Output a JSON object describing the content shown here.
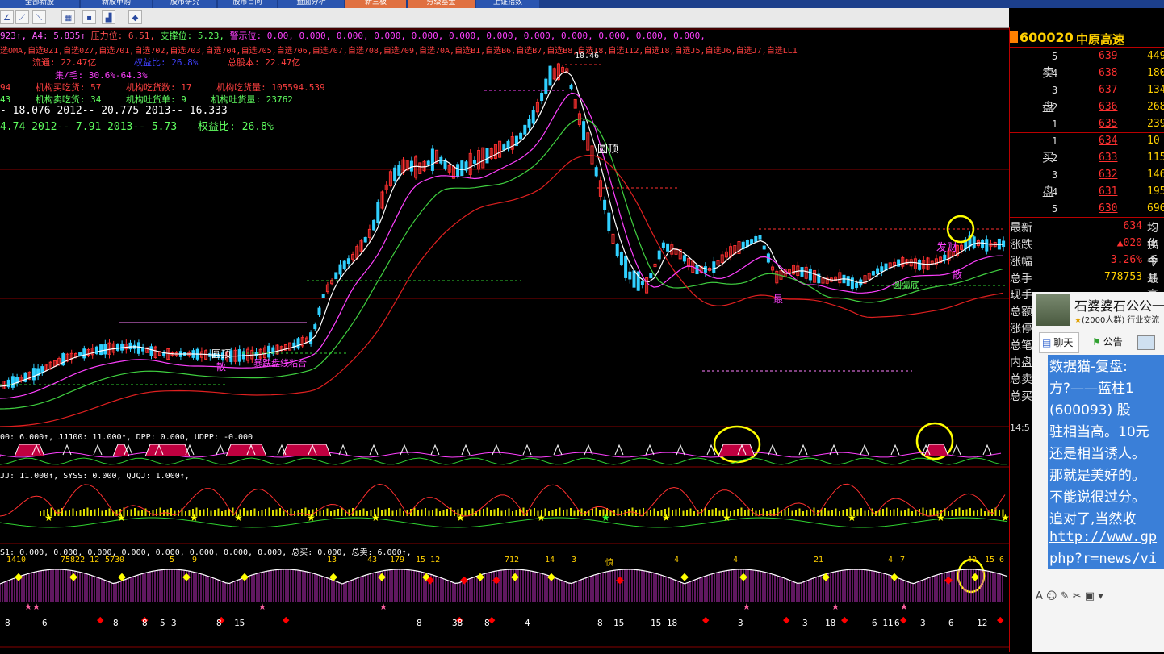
{
  "tabs": [
    {
      "label": "全部新股",
      "bg": "#2a55b0"
    },
    {
      "label": "新股申购",
      "bg": "#2a55b0"
    },
    {
      "label": "股市研究",
      "bg": "#2a55b0"
    },
    {
      "label": "股市百问",
      "bg": "#2a55b0"
    },
    {
      "label": "盘面分析",
      "bg": "#2a55b0"
    },
    {
      "label": "新三板",
      "bg": "#e07040"
    },
    {
      "label": "分级基金",
      "bg": "#e07040"
    },
    {
      "label": "上证指数",
      "bg": "#2a55b0"
    }
  ],
  "toolbar": {
    "icons": [
      "angle-tool-icon",
      "line-tool-icon",
      "ray-tool-icon",
      "table-icon",
      "note-icon",
      "chart-settings-icon",
      "diamond-icon"
    ]
  },
  "info": {
    "line1_a": "923↑, A4: 5.835↑",
    "line1_b": "压力位: 6.51,",
    "line1_c": "支撑位: 5.23,",
    "line1_d": "警示位: 0.00, 0.000, 0.000, 0.000, 0.000, 0.000, 0.000, 0.000, 0.000, 0.000, 0.000, 0.000,",
    "line2": "选OMA,自选0Z1,自选0Z7,自选701,自选702,自选703,自选704,自选705,自选706,自选707,自选708,自选709,自选70A,自选B1,自选B6,自选B7,自选B8,自选I8,自选II2,自选I8,自选J5,自选J6,自选J7,自选LL1",
    "line3_a": "流通: 22.47亿",
    "line3_b": "权益比: 26.8%",
    "line3_c": "总股本: 22.47亿",
    "line4": "集/毛: 30.6%-64.3%",
    "line5_a": "94",
    "line5_b": "机构买吃货: 57",
    "line5_c": "机构吃货数: 17",
    "line5_d": "机构吃货量: 105594.539",
    "line6_a": "43",
    "line6_b": "机构卖吃货: 34",
    "line6_c": "机构吐货单: 9",
    "line6_d": "机构吐货量: 23762",
    "line7": "- 18.076   2012-- 20.775   2013-- 16.333",
    "line8_a": "4.74   2012-- 7.91   2013-- 5.73",
    "line8_b": "权益比: 26.8%"
  },
  "chart": {
    "price_high_label": "10.46",
    "labels": [
      "圆顶",
      "圆顶",
      "圆弧底",
      "暴跌盘线粘合",
      "散",
      "发财",
      "散",
      "最"
    ],
    "panel1_label": "00: 6.000↑, JJJ00: 11.000↑, DPP: 0.000, UDPP: -0.000",
    "panel2_label": "JJ: 11.000↑, SYSS: 0.000, QJQJ: 1.000↑,",
    "panel3_label_a": "S1: 0.000, 0.000, 0.000, 0.000, 0.000, 0.000, 0.000, 0.000,",
    "panel3_label_b": "总买: 0.000,",
    "panel3_label_c": "总卖: 6.000↑,",
    "panel3_numbers": [
      "1410",
      "75822 12",
      "5730",
      "5",
      "9",
      "13",
      "43",
      "179",
      "15 12",
      "712",
      "14",
      "3",
      "慎",
      "4",
      "4",
      "21",
      "4",
      "7",
      "40",
      "15",
      "6"
    ],
    "panel3_bottom": [
      "8",
      "6",
      "8",
      "8",
      "5",
      "3",
      "8",
      "15",
      "8",
      "38",
      "8",
      "4",
      "8",
      "15",
      "15 18",
      "3",
      "3",
      "18",
      "6 11",
      "6",
      "3",
      "6",
      "12"
    ]
  },
  "quote": {
    "code": "600020",
    "name": "中原高速",
    "sell_label_1": "卖",
    "sell_label_2": "盘",
    "buy_label_1": "买",
    "buy_label_2": "盘",
    "sell": [
      {
        "level": "5",
        "price": "639",
        "vol": "449"
      },
      {
        "level": "4",
        "price": "638",
        "vol": "180"
      },
      {
        "level": "3",
        "price": "637",
        "vol": "134"
      },
      {
        "level": "2",
        "price": "636",
        "vol": "268"
      },
      {
        "level": "1",
        "price": "635",
        "vol": "239"
      }
    ],
    "buy": [
      {
        "level": "1",
        "price": "634",
        "vol": "10"
      },
      {
        "level": "2",
        "price": "633",
        "vol": "115"
      },
      {
        "level": "3",
        "price": "632",
        "vol": "146"
      },
      {
        "level": "4",
        "price": "631",
        "vol": "195"
      },
      {
        "level": "5",
        "price": "630",
        "vol": "696"
      }
    ],
    "stats": [
      {
        "label": "最新",
        "value": "634",
        "extra": "均化"
      },
      {
        "label": "涨跌",
        "value": "▲020",
        "extra": "换手"
      },
      {
        "label": "涨幅",
        "value": "3.26%",
        "extra": "今开"
      },
      {
        "label": "总手",
        "value": "778753",
        "extra": "最高"
      }
    ],
    "more_labels": [
      "现手",
      "总额",
      "涨停",
      "总笔",
      "内盘",
      "总卖",
      "总买"
    ],
    "time": "14:5"
  },
  "qq": {
    "group_name": "石婆婆石公公一",
    "group_meta": "(2000人群) 行业交流",
    "tab_chat": "聊天",
    "tab_notice": "公告",
    "message_lines": [
      "数据猫-复盘:",
      "方?——蓝柱1",
      "(600093) 股",
      "驻相当高。10元",
      "还是相当诱人。",
      "那就是美好的。",
      "不能说很过分。",
      "追对了,当然收"
    ],
    "link_lines": [
      "http://www.gp",
      "php?r=news/vi"
    ]
  },
  "colors": {
    "up": "#ff3030",
    "down": "#30d0ff",
    "ma_white": "#ffffff",
    "ma_magenta": "#ff40ff",
    "ma_green": "#40d040",
    "ma_red": "#e02020",
    "yellow": "#ffff00"
  }
}
